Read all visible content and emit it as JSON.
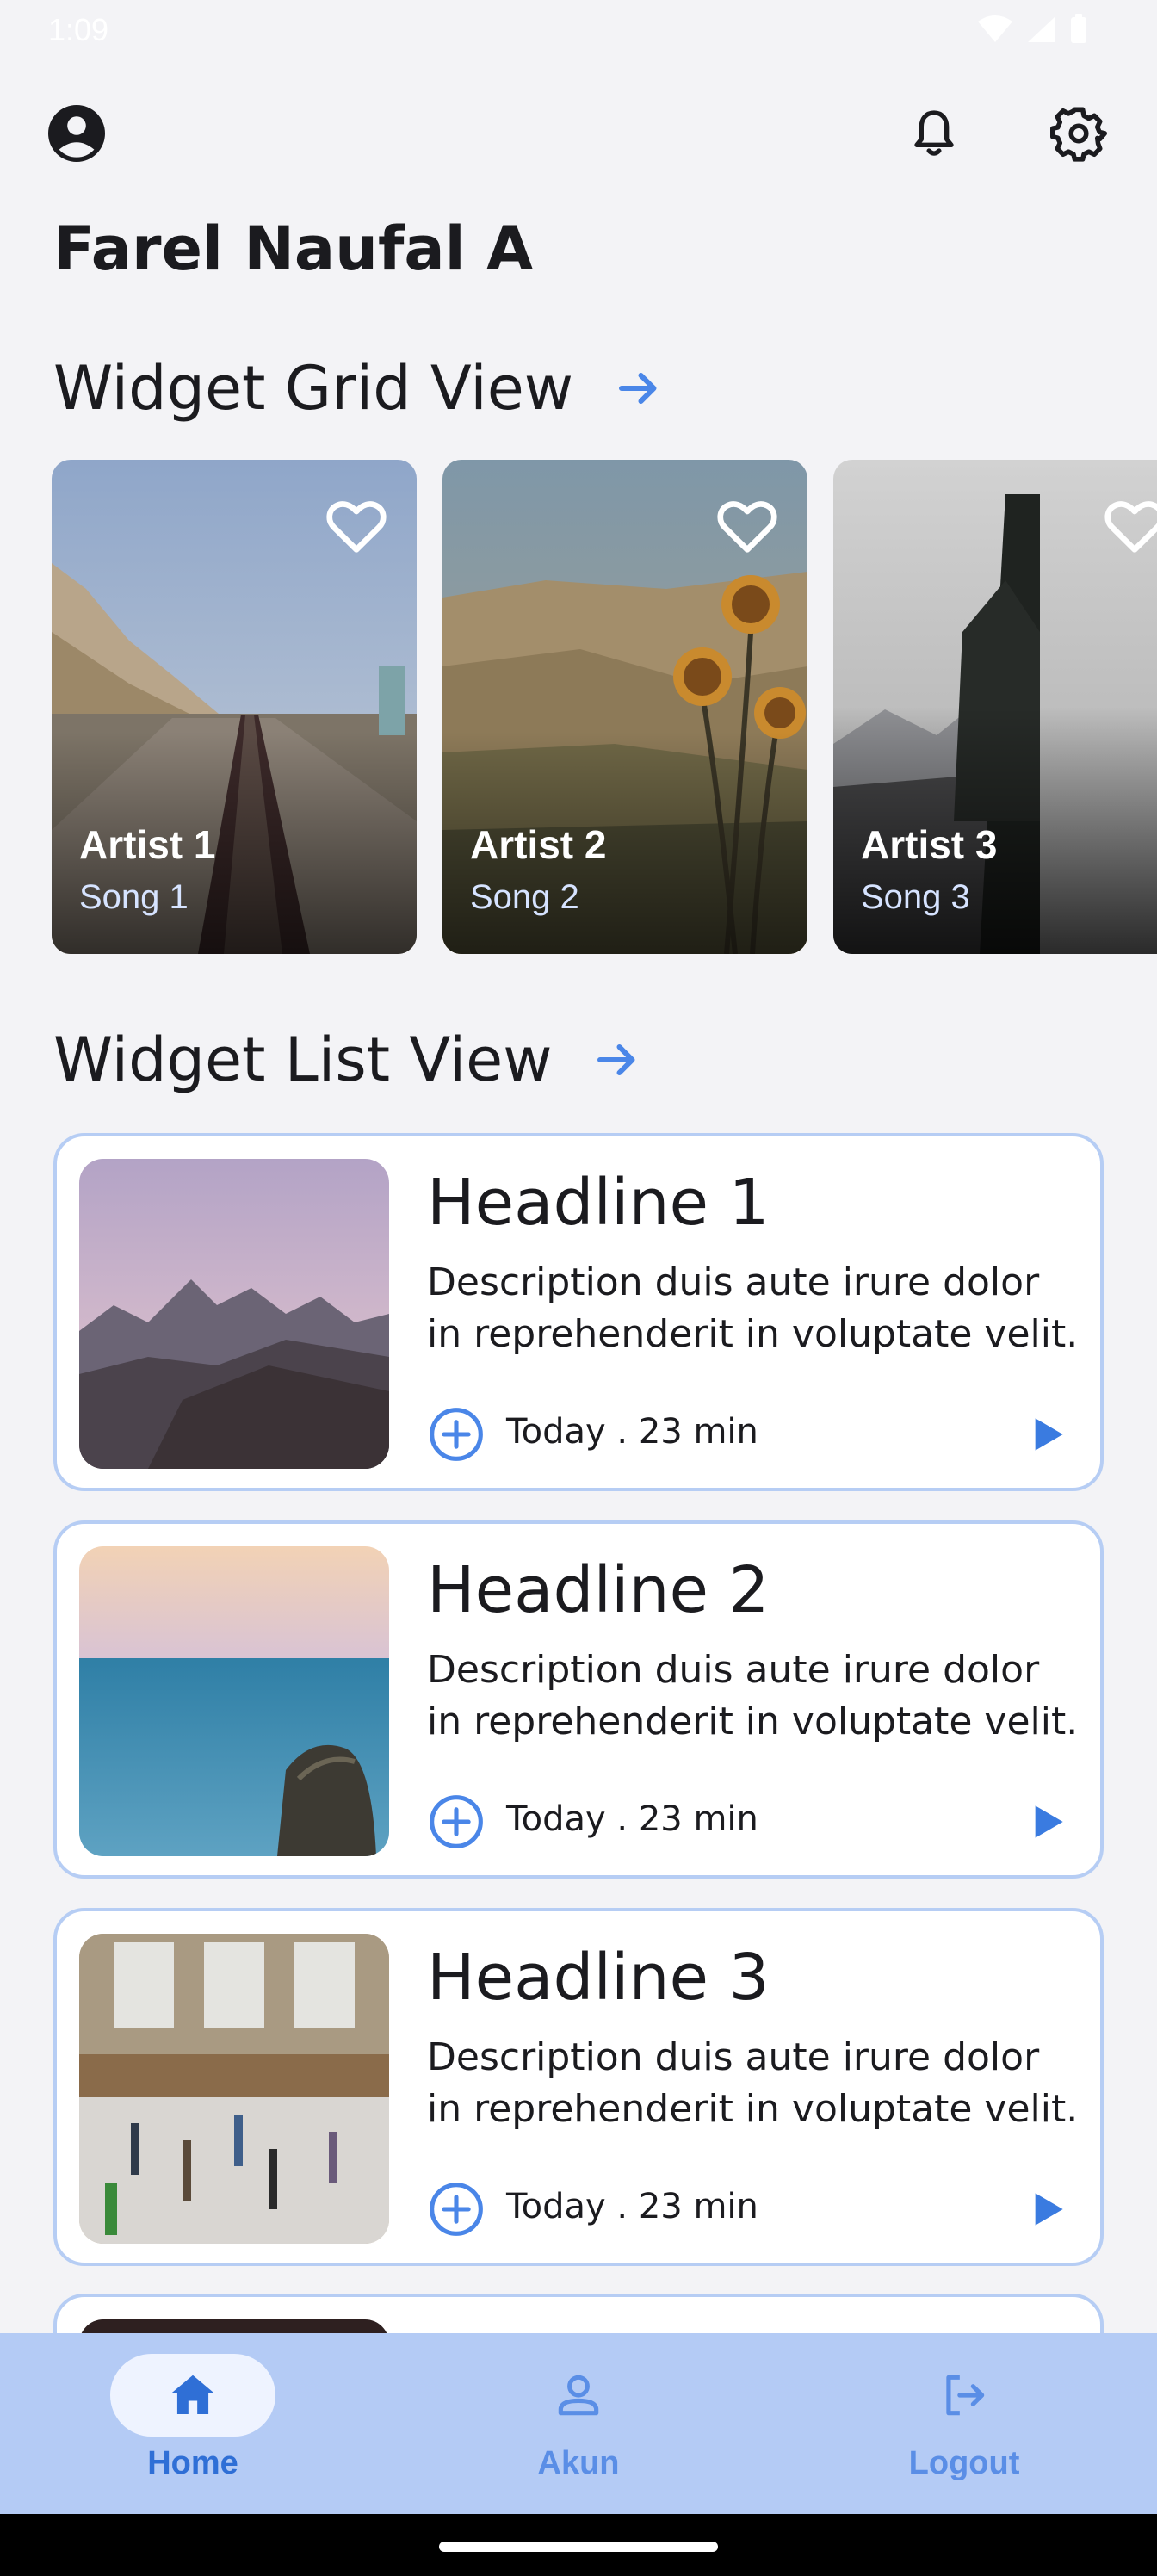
{
  "status_bar": {
    "time": "1:09"
  },
  "header": {
    "user_name": "Farel Naufal A"
  },
  "icons": {
    "profile": "account-circle-icon",
    "notifications": "bell-icon",
    "settings": "gear-icon"
  },
  "grid_section": {
    "title": "Widget Grid View",
    "cards": [
      {
        "artist": "Artist 1",
        "song": "Song 1"
      },
      {
        "artist": "Artist 2",
        "song": "Song 2"
      },
      {
        "artist": "Artist 3",
        "song": "Song 3"
      }
    ]
  },
  "list_section": {
    "title": "Widget List View",
    "items": [
      {
        "headline": "Headline 1",
        "description": "Description duis aute irure dolor in reprehenderit in voluptate velit.",
        "meta": "Today . 23 min"
      },
      {
        "headline": "Headline 2",
        "description": "Description duis aute irure dolor in reprehenderit in voluptate velit.",
        "meta": "Today . 23 min"
      },
      {
        "headline": "Headline 3",
        "description": "Description duis aute irure dolor in reprehenderit in voluptate velit.",
        "meta": "Today . 23 min"
      }
    ]
  },
  "bottom_nav": {
    "items": [
      {
        "label": "Home",
        "icon": "home-icon",
        "active": true
      },
      {
        "label": "Akun",
        "icon": "person-icon",
        "active": false
      },
      {
        "label": "Logout",
        "icon": "logout-icon",
        "active": false
      }
    ]
  },
  "colors": {
    "accent": "#4a86e8",
    "nav_background": "#b4cbf5",
    "nav_active_label": "#2f6fd6",
    "nav_inactive_label": "#5a8ee6",
    "card_border": "#b6cdf4"
  }
}
